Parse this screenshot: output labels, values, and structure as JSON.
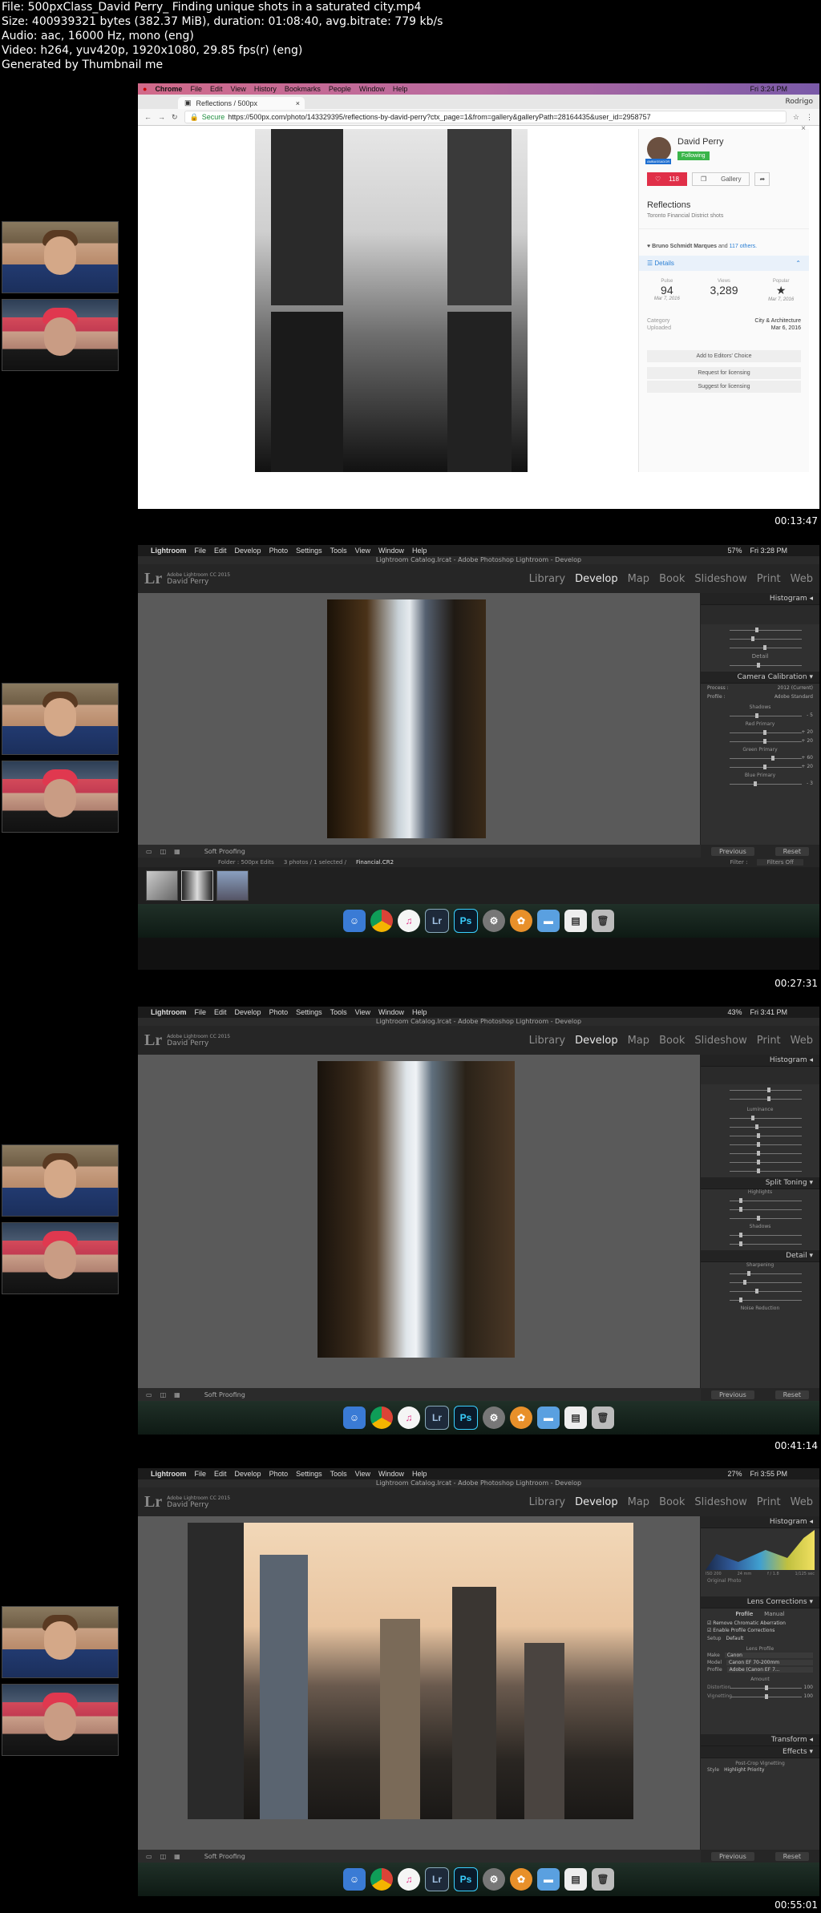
{
  "file_info": [
    "File: 500pxClass_David Perry_ Finding unique shots in a saturated city.mp4",
    "Size: 400939321 bytes (382.37 MiB), duration: 01:08:40, avg.bitrate: 779 kb/s",
    "Audio: aac, 16000 Hz, mono (eng)",
    "Video: h264, yuv420p, 1920x1080, 29.85 fps(r) (eng)",
    "Generated by Thumbnail me"
  ],
  "frame1": {
    "timestamp": "00:13:47",
    "mac_menu": [
      "Chrome",
      "File",
      "Edit",
      "View",
      "History",
      "Bookmarks",
      "People",
      "Window",
      "Help"
    ],
    "mac_clock": "Fri 3:24 PM",
    "tab_title": "Reflections / 500px",
    "user_name": "Rodrigo",
    "secure_label": "Secure",
    "url": "https://500px.com/photo/143329395/reflections-by-david-perry?ctx_page=1&from=gallery&galleryPath=28164435&user_id=2958757",
    "panel": {
      "author": "David Perry",
      "badge": "AMBASSADOR",
      "following": "Following",
      "likes": "118",
      "gallery": "Gallery",
      "title": "Reflections",
      "subtitle": "Toronto Financial District shots",
      "liked_by": "Bruno Schmidt Marques",
      "liked_and": "and",
      "liked_others": "117 others.",
      "details": "Details",
      "stats": [
        {
          "label": "Pulse",
          "value": "94",
          "date": "Mar 7, 2016"
        },
        {
          "label": "Views",
          "value": "3,289",
          "date": ""
        },
        {
          "label": "Popular",
          "value": "★",
          "date": "Mar 7, 2016"
        }
      ],
      "category_label": "Category",
      "category": "City & Architecture",
      "uploaded_label": "Uploaded",
      "uploaded": "Mar 6, 2016",
      "actions": [
        "Add to Editors' Choice",
        "Request for licensing",
        "Suggest for licensing"
      ]
    }
  },
  "lr_common": {
    "menu": [
      "Lightroom",
      "File",
      "Edit",
      "Develop",
      "Photo",
      "Settings",
      "Tools",
      "View",
      "Window",
      "Help"
    ],
    "window_title": "Lightroom Catalog.lrcat - Adobe Photoshop Lightroom - Develop",
    "version": "Adobe Lightroom CC 2015",
    "user": "David Perry",
    "modules": [
      "Library",
      "Develop",
      "Map",
      "Book",
      "Slideshow",
      "Print",
      "Web"
    ],
    "soft_proofing": "Soft Proofing",
    "previous": "Previous",
    "reset": "Reset",
    "dock": [
      "Finder",
      "Chrome",
      "iTunes",
      "Lr",
      "Ps",
      "Settings",
      "App",
      "Folder",
      "File",
      "Trash"
    ]
  },
  "frame2": {
    "timestamp": "00:27:31",
    "clock": "Fri 3:28 PM",
    "battery": "57%",
    "panels": [
      "Histogram",
      "Detail",
      "Camera Calibration"
    ],
    "process": "2012 (Current)",
    "profile": "Adobe Standard",
    "groups": [
      "Shadows",
      "Red Primary",
      "Green Primary",
      "Blue Primary"
    ],
    "values": [
      "+ 20",
      "+ 20",
      "+ 60",
      "+ 20",
      "- 5",
      "- 3"
    ],
    "folder": "Folder : 500px Edits",
    "selection": "3 photos / 1 selected /",
    "filename": "Financial.CR2",
    "filter_label": "Filter :",
    "filter_value": "Filters Off"
  },
  "frame3": {
    "timestamp": "00:41:14",
    "clock": "Fri 3:41 PM",
    "battery": "43%",
    "panels": [
      "Histogram",
      "Split Toning",
      "Detail"
    ],
    "groups": [
      "Luminance",
      "Highlights",
      "Shadows",
      "Sharpening",
      "Noise Reduction"
    ]
  },
  "frame4": {
    "timestamp": "00:55:01",
    "clock": "Fri 3:55 PM",
    "battery": "27%",
    "panels": [
      "Histogram",
      "Lens Corrections",
      "Transform",
      "Effects"
    ],
    "histogram_readout": [
      "ISO 200",
      "24 mm",
      "f / 1.8",
      "1/125 sec"
    ],
    "original_photo": "Original Photo",
    "lens_tabs": [
      "Profile",
      "Manual"
    ],
    "checks": [
      "Remove Chromatic Aberration",
      "Enable Profile Corrections"
    ],
    "setup_label": "Setup",
    "setup": "Default",
    "lens_profile_head": "Lens Profile",
    "make_label": "Make",
    "make": "Canon",
    "model_label": "Model",
    "model": "Canon EF 70-200mm",
    "profile_label": "Profile",
    "profile": "Adobe (Canon EF 7...",
    "amount": "Amount",
    "distortion": "Distortion",
    "vignetting": "Vignetting",
    "post_crop": "Post-Crop Vignetting",
    "style_label": "Style",
    "style": "Highlight Priority",
    "am_values": [
      "100",
      "100"
    ]
  }
}
